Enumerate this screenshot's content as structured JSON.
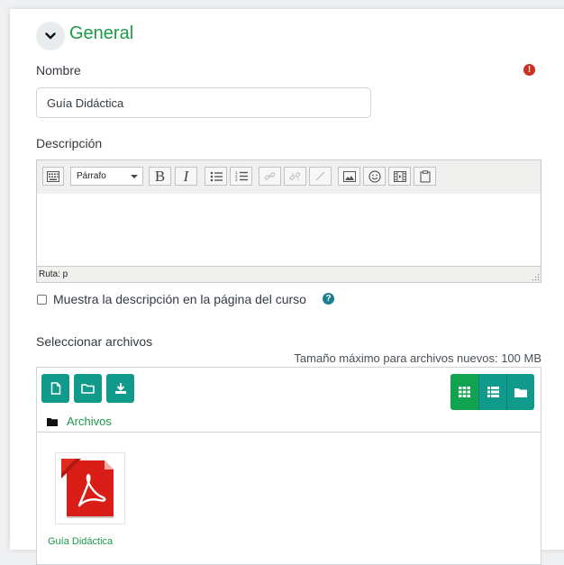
{
  "section": {
    "title": "General",
    "collapse_icon": "chevron-down-icon"
  },
  "nombre": {
    "label": "Nombre",
    "value": "Guía Didáctica",
    "required_icon": "exclamation-circle-icon",
    "required_color": "#ca3120"
  },
  "descripcion": {
    "label": "Descripción",
    "format_select": "Párrafo",
    "toolbar": {
      "bold": "B",
      "italic": "I"
    },
    "status_path": "Ruta: p"
  },
  "show_description": {
    "label": "Muestra la descripción en la página del curso",
    "help_icon": "question-circle-icon",
    "checked": false
  },
  "files": {
    "label": "Seleccionar archivos",
    "max_size": "Tamaño máximo para archivos nuevos: 100 MB",
    "path_label": "Archivos",
    "file_name": "Guía Didáctica",
    "file_icon": "pdf-file-icon",
    "accent_color": "#0f9a8c",
    "active_view_color": "#11a34f"
  }
}
